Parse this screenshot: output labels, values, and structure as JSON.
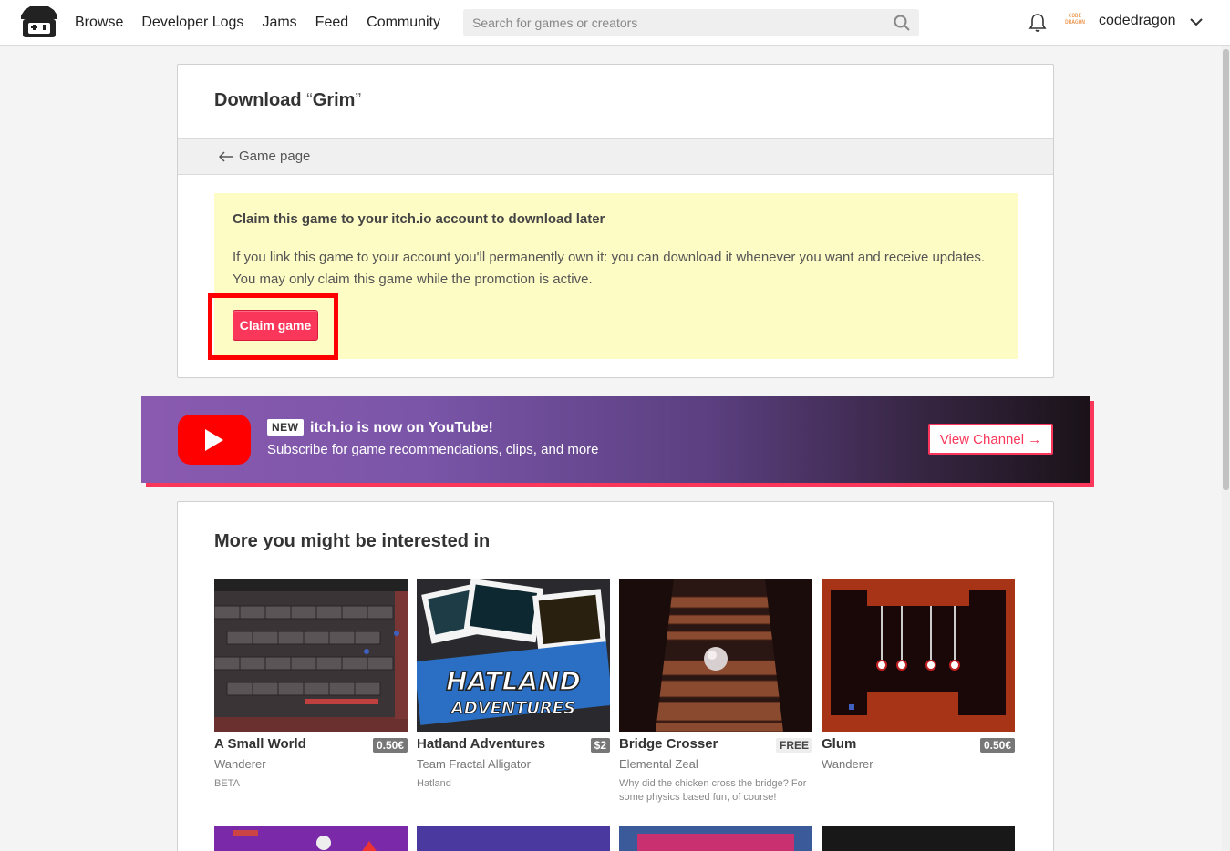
{
  "header": {
    "nav": [
      "Browse",
      "Developer Logs",
      "Jams",
      "Feed",
      "Community"
    ],
    "search_placeholder": "Search for games or creators",
    "username": "codedragon",
    "avatar_text": "CODE DRAGON"
  },
  "download": {
    "title_prefix": "Download ",
    "open_quote": "“",
    "game_name": "Grim",
    "close_quote": "”",
    "back_label": "Game page",
    "claim_title": "Claim this game to your itch.io account to download later",
    "claim_text": "If you link this game to your account you'll permanently own it: you can download it whenever you want and receive updates. You may only claim this game while the promotion is active.",
    "claim_button": "Claim game"
  },
  "banner": {
    "tag": "NEW",
    "title": "itch.io is now on YouTube!",
    "subtitle": "Subscribe for game recommendations, clips, and more",
    "button": "View Channel →"
  },
  "recommendations": {
    "heading": "More you might be interested in",
    "games": [
      {
        "title": "A Small World",
        "price": "0.50€",
        "author": "Wanderer",
        "desc": "BETA"
      },
      {
        "title": "Hatland Adventures",
        "price": "$2",
        "author": "Team Fractal Alligator",
        "desc": "Hatland"
      },
      {
        "title": "Bridge Crosser",
        "price": "FREE",
        "author": "Elemental Zeal",
        "desc": "Why did the chicken cross the bridge? For some physics based fun, of course!"
      },
      {
        "title": "Glum",
        "price": "0.50€",
        "author": "Wanderer",
        "desc": ""
      }
    ]
  },
  "colors": {
    "accent": "#fa375a",
    "claim_bg": "#fefcc5",
    "highlight": "#ff0000"
  }
}
